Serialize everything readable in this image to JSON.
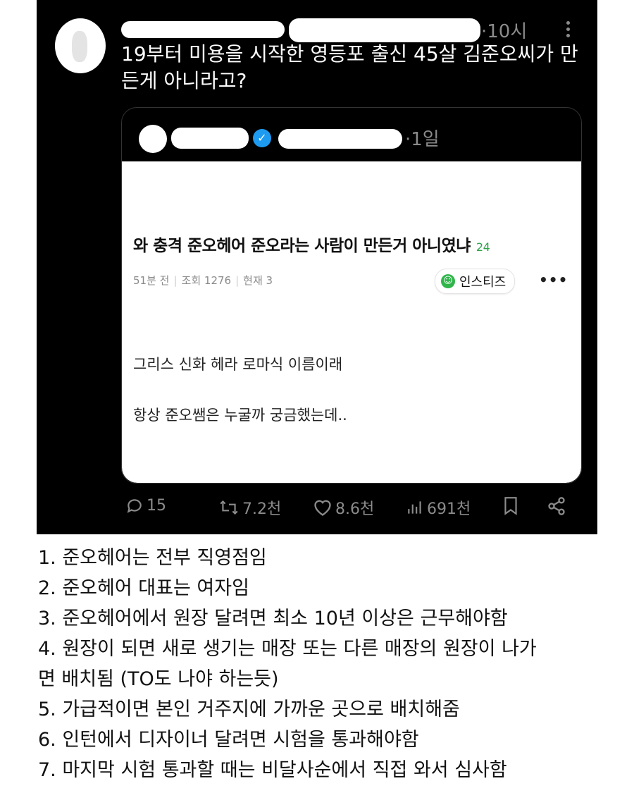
{
  "post": {
    "time": "·10시",
    "text": "19부터 미용을 시작한 영등포 출신 45살 김준오씨가 만든게 아니라고?"
  },
  "quoted": {
    "time": "·1일",
    "article": {
      "title": "와 충격 준오헤어 준오라는 사람이 만든거 아니였냐",
      "comment_count": "24",
      "posted": "51분 전",
      "views": "조회 1276",
      "current": "현재 3",
      "board": "인스티즈",
      "body_line1": "그리스 신화 헤라 로마식 이름이래",
      "body_line2": "항상 준오쌤은 누굴까 궁금했는데.."
    }
  },
  "actions": {
    "replies": "15",
    "reposts": "7.2천",
    "likes": "8.6천",
    "views": "691천"
  },
  "notes": [
    "1. 준오헤어는 전부 직영점임",
    "2. 준오헤어 대표는 여자임",
    "3. 준오헤어에서 원장 달려면 최소 10년 이상은 근무해야함",
    "4. 원장이 되면 새로 생기는 매장 또는 다른 매장의 원장이 나가",
    "면 배치됨 (TO도 나야 하는듯)",
    "5. 가급적이면 본인 거주지에 가까운 곳으로 배치해줌",
    "6. 인턴에서 디자이너 달려면 시험을 통과해야함",
    "7. 마지막 시험 통과할 때는 비달사순에서 직접 와서 심사함"
  ],
  "colors": {
    "background": "#000000",
    "verified": "#1d9bf0",
    "comment_count": "#2fa34a",
    "muted": "#8b8b8b"
  }
}
